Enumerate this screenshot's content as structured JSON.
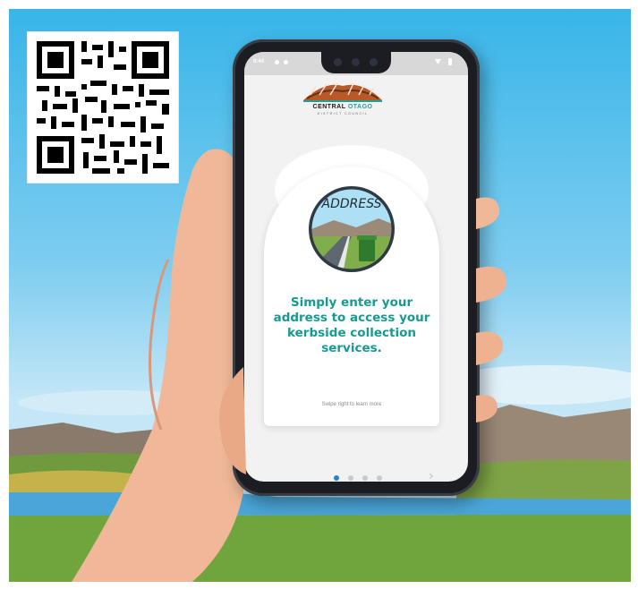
{
  "statusbar": {
    "time": "9:44"
  },
  "brand": {
    "name_part1": "CENTRAL",
    "name_part2": "OTAGO",
    "subtitle": "DISTRICT COUNCIL"
  },
  "onboarding": {
    "illustration_label": "ADDRESS",
    "headline": "Simply enter your address to access your kerbside collection services.",
    "hint": "Swipe right to learn more",
    "current_page": 1,
    "page_count": 4,
    "next_icon": "chevron-right-icon"
  },
  "icons": {
    "qr": "qr-code-icon",
    "logo": "council-logo-icon"
  },
  "colors": {
    "accent_teal": "#179a90",
    "dot_active": "#2f7dd1",
    "dot_inactive": "#c9c9c9",
    "sky": "#38b5e8"
  }
}
